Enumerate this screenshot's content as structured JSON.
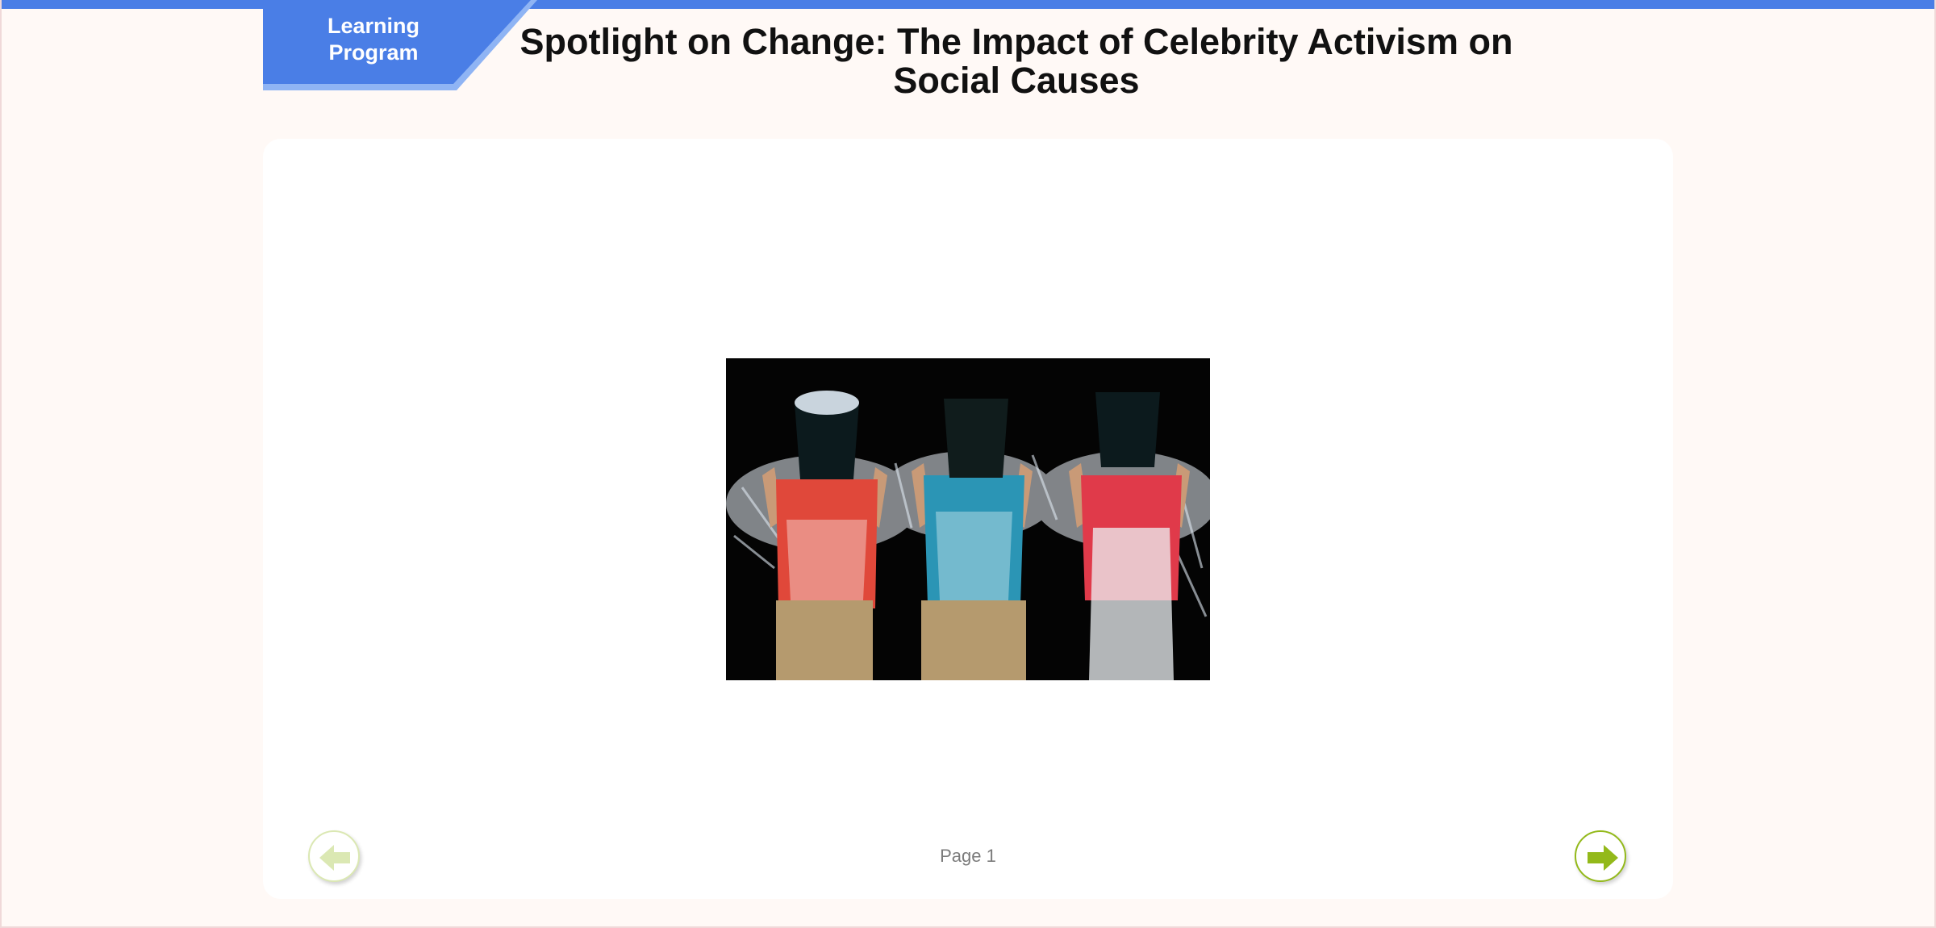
{
  "header": {
    "badge_line1": "Learning",
    "badge_line2": "Program",
    "title": "Spotlight on Change: The Impact of Celebrity Activism on Social Causes"
  },
  "content": {
    "image_icon": "ice-bucket-challenge-photo"
  },
  "footer": {
    "page_label": "Page 1",
    "prev_icon": "arrow-left-icon",
    "next_icon": "arrow-right-icon"
  },
  "colors": {
    "accent_blue": "#4a7ee6",
    "nav_green": "#93b91a",
    "nav_green_disabled": "#dbe8b3",
    "background": "#fff9f6"
  }
}
